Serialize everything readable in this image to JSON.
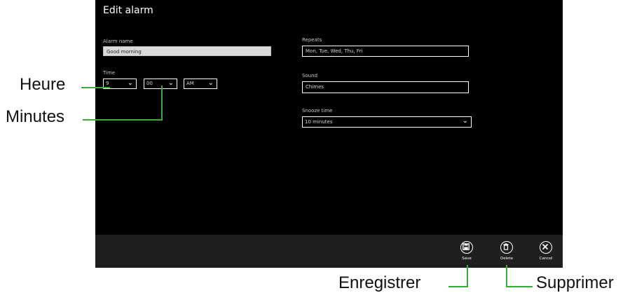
{
  "window": {
    "title": "Edit alarm"
  },
  "form": {
    "alarm_name_label": "Alarm name",
    "alarm_name_value": "Good morning",
    "time_label": "Time",
    "hour_value": "9",
    "minute_value": "00",
    "ampm_value": "AM",
    "repeats_label": "Repeats",
    "repeats_value": "Mon, Tue, Wed, Thu, Fri",
    "sound_label": "Sound",
    "sound_value": "Chimes",
    "snooze_label": "Snooze time",
    "snooze_value": "10 minutes"
  },
  "appbar": {
    "save_label": "Save",
    "delete_label": "Delete",
    "cancel_label": "Cancel"
  },
  "callouts": {
    "heure": "Heure",
    "minutes": "Minutes",
    "enregistrer": "Enregistrer",
    "supprimer": "Supprimer"
  },
  "icons": {
    "chevron": "chevron-down-icon",
    "save": "save-icon",
    "delete": "trash-icon",
    "cancel": "close-icon"
  },
  "colors": {
    "callout_line": "#3cab3a",
    "background": "#000000",
    "appbar": "#1f1f1f"
  }
}
